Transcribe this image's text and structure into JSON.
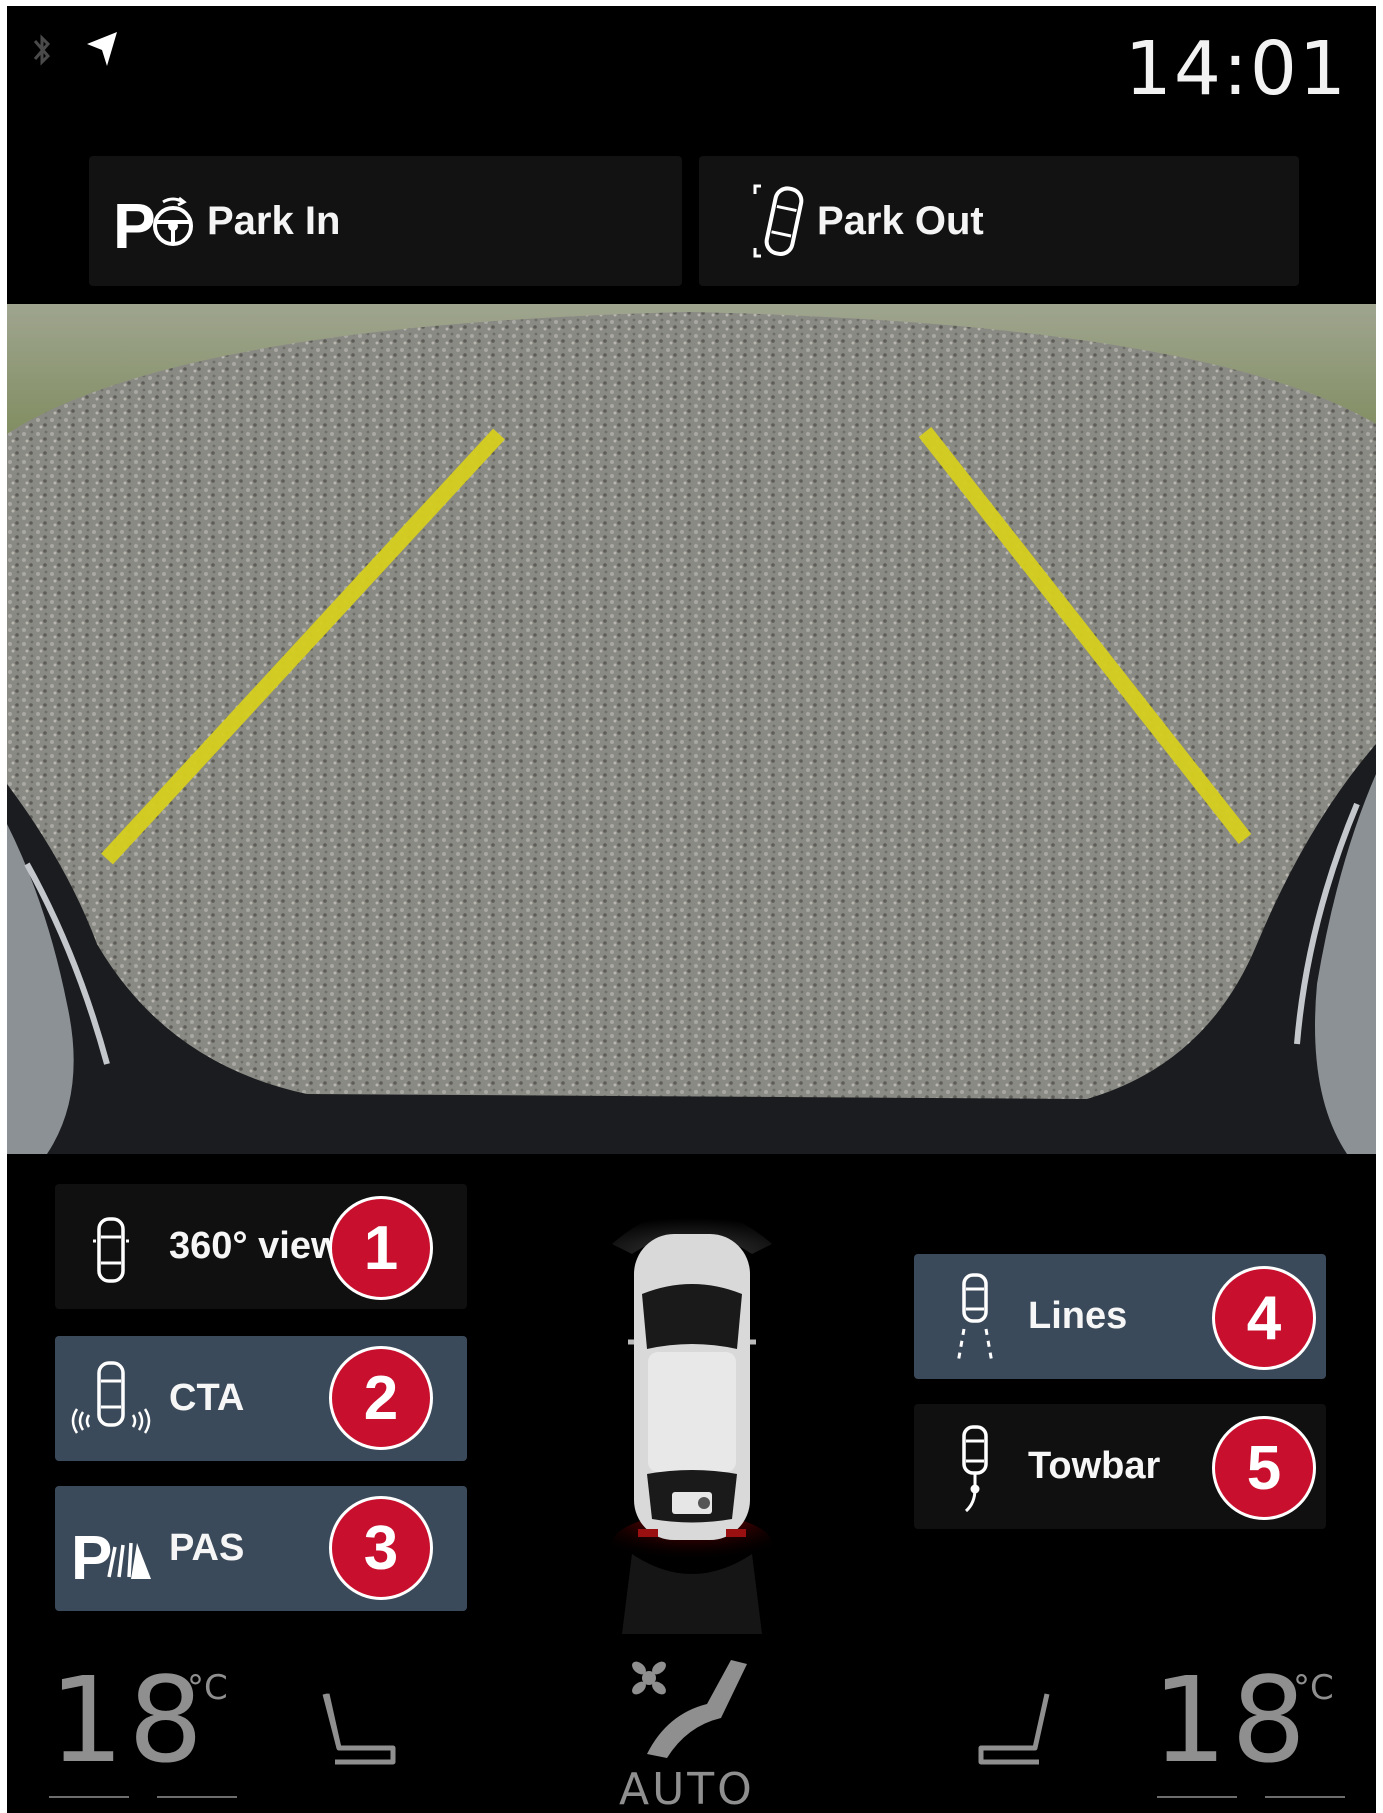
{
  "status": {
    "time": "14:01"
  },
  "park": {
    "park_in": "Park In",
    "park_out": "Park Out"
  },
  "controls": {
    "view360": {
      "label": "360° view",
      "number": "1"
    },
    "cta": {
      "label": "CTA",
      "number": "2"
    },
    "pas": {
      "label": "PAS",
      "number": "3"
    },
    "lines": {
      "label": "Lines",
      "number": "4"
    },
    "towbar": {
      "label": "Towbar",
      "number": "5"
    }
  },
  "climate": {
    "left_temp": "18",
    "right_temp": "18",
    "unit": "°C",
    "fan_mode": "AUTO"
  },
  "icons": {
    "bluetooth": "bluetooth-icon",
    "navigation": "navigation-arrow-icon",
    "park_in": "park-assist-steering-icon",
    "park_out": "park-out-car-icon",
    "seat": "seat-heat-icon",
    "fan": "fan-airflow-icon"
  },
  "colors": {
    "badge": "#c8102e",
    "active_button": "#3b4a5a",
    "guide_lines": "#d6cf1e"
  }
}
